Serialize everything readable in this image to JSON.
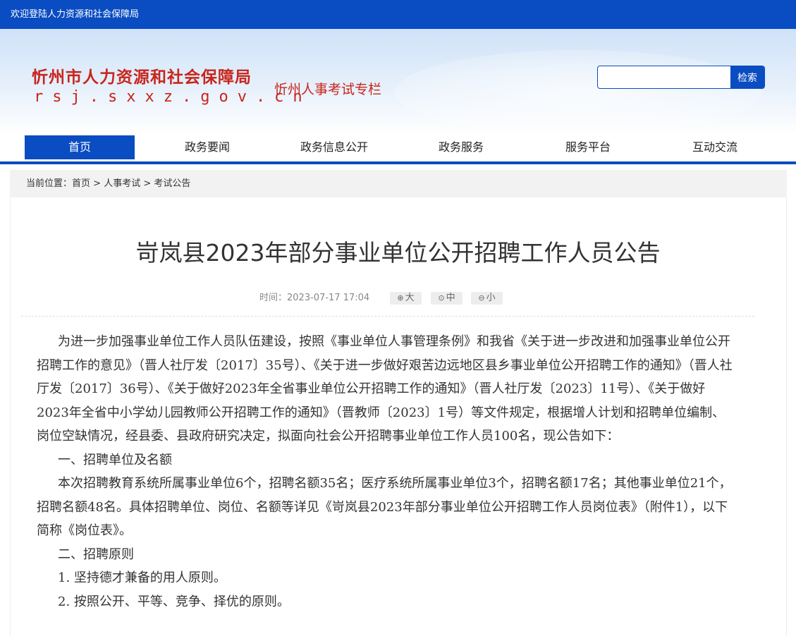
{
  "topbar": {
    "welcome": "欢迎登陆人力资源和社会保障局"
  },
  "header": {
    "org_name": "忻州市人力资源和社会保障局",
    "domain": "rsj.sxxz.gov.cn",
    "section": "忻州人事考试专栏"
  },
  "search": {
    "placeholder": "",
    "value": "",
    "button": "检索"
  },
  "nav": {
    "items": [
      {
        "label": "首页",
        "active": true
      },
      {
        "label": "政务要闻"
      },
      {
        "label": "政务信息公开"
      },
      {
        "label": "政务服务"
      },
      {
        "label": "服务平台"
      },
      {
        "label": "互动交流"
      }
    ]
  },
  "breadcrumb": {
    "prefix": "当前位置：",
    "items": [
      "首页",
      "人事考试",
      "考试公告"
    ],
    "sep": " > "
  },
  "article": {
    "title": "岢岚县2023年部分事业单位公开招聘工作人员公告",
    "time_label": "时间：",
    "time": "2023-07-17 17:04",
    "font_sizes": [
      "大",
      "中",
      "小"
    ],
    "paragraphs": [
      "为进一步加强事业单位工作人员队伍建设，按照《事业单位人事管理条例》和我省《关于进一步改进和加强事业单位公开招聘工作的意见》（晋人社厅发〔2017〕35号）、《关于进一步做好艰苦边远地区县乡事业单位公开招聘工作的通知》（晋人社厅发〔2017〕36号）、《关于做好2023年全省事业单位公开招聘工作的通知》（晋人社厅发〔2023〕11号）、《关于做好2023年全省中小学幼儿园教师公开招聘工作的通知》（晋教师〔2023〕1号）等文件规定，根据增人计划和招聘单位编制、岗位空缺情况，经县委、县政府研究决定，拟面向社会公开招聘事业单位工作人员100名，现公告如下：",
      "一、招聘单位及名额",
      "本次招聘教育系统所属事业单位6个，招聘名额35名；医疗系统所属事业单位3个，招聘名额17名；其他事业单位21个，招聘名额48名。具体招聘单位、岗位、名额等详见《岢岚县2023年部分事业单位公开招聘工作人员岗位表》（附件1），以下简称《岗位表》。",
      "二、招聘原则",
      "1. 坚持德才兼备的用人原则。",
      "2. 按照公开、平等、竞争、择优的原则。"
    ]
  },
  "colors": {
    "brand": "#0a4cc1",
    "logo_red": "#c8251c"
  }
}
